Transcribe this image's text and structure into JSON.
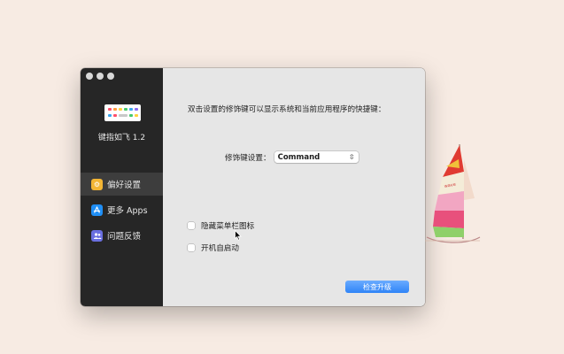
{
  "sidebar": {
    "app_title": "键指如飞 1.2",
    "items": [
      {
        "label": "偏好设置",
        "icon": "gear-icon",
        "icon_color": "#f3b534",
        "active": true
      },
      {
        "label": "更多 Apps",
        "icon": "app-store-icon",
        "icon_color": "#1f8ef5",
        "active": false
      },
      {
        "label": "问题反馈",
        "icon": "people-icon",
        "icon_color": "#6a6fe0",
        "active": false
      }
    ]
  },
  "main": {
    "description": "双击设置的修饰键可以显示系统和当前应用程序的快捷键：",
    "modifier_label": "修饰键设置：",
    "modifier_value": "Command",
    "hide_menubar_label": "隐藏菜单栏图标",
    "launch_login_label": "开机自启动",
    "update_button": "检查升级"
  },
  "colors": {
    "background": "#f7ebe3",
    "sidebar": "#262626",
    "panel": "#e6e6e6",
    "accent": "#2f84f7"
  }
}
